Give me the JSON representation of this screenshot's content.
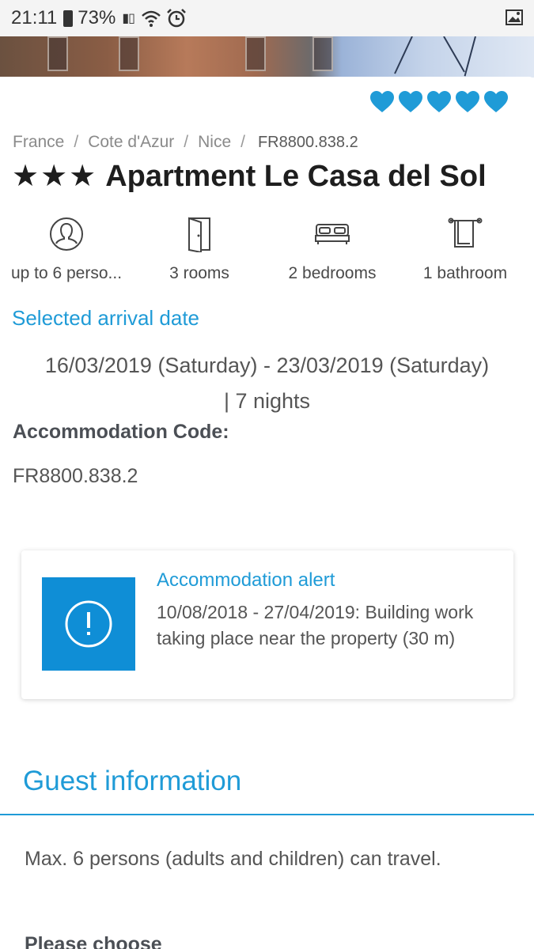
{
  "status_bar": {
    "time": "21:11",
    "battery": "73%",
    "icons": [
      "battery-icon",
      "signal-icon",
      "wifi-icon",
      "alarm-icon",
      "gallery-icon"
    ]
  },
  "rating": {
    "hearts": 5,
    "color": "#1f9bd7"
  },
  "breadcrumb": {
    "items": [
      "France",
      "Cote d'Azur",
      "Nice"
    ],
    "separator": "/",
    "code": "FR8800.838.2"
  },
  "title": {
    "stars": "★★★",
    "name": "Apartment Le Casa del Sol"
  },
  "features": [
    {
      "icon": "person-icon",
      "label": "up to 6 perso..."
    },
    {
      "icon": "door-icon",
      "label": "3 rooms"
    },
    {
      "icon": "bed-icon",
      "label": "2 bedrooms"
    },
    {
      "icon": "bathroom-icon",
      "label": "1 bathroom"
    }
  ],
  "arrival": {
    "heading": "Selected arrival date",
    "line1": "16/03/2019 (Saturday) - 23/03/2019 (Saturday)",
    "line2": "| 7 nights"
  },
  "accommodation": {
    "code_label": "Accommodation Code:",
    "code_value": "FR8800.838.2"
  },
  "alert": {
    "icon": "exclamation-icon",
    "title": "Accommodation alert",
    "text": "10/08/2018 - 27/04/2019: Building work taking place near the property (30 m)"
  },
  "guest": {
    "heading": "Guest information",
    "text": "Max. 6 persons (adults and children) can travel.",
    "please": "Please choose"
  },
  "colors": {
    "accent": "#1f9bd7",
    "alert_box": "#0f8ed6",
    "title": "#1e1e1e"
  }
}
